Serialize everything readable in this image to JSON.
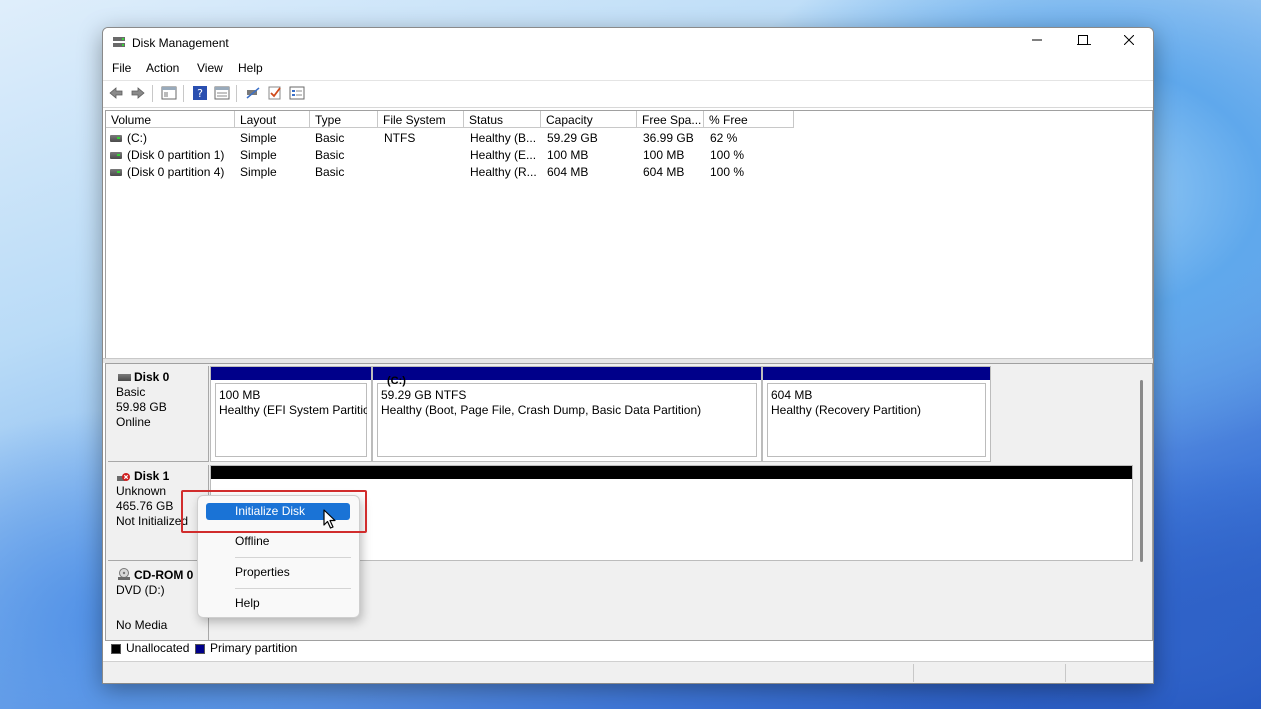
{
  "window": {
    "title": "Disk Management",
    "controls": {
      "minimize": "—",
      "maximize": "☐",
      "close": "✕"
    }
  },
  "menu": [
    "File",
    "Action",
    "View",
    "Help"
  ],
  "toolbar_icons": [
    "back-arrow-icon",
    "forward-arrow-icon",
    "console-tree-icon",
    "help-icon",
    "properties-icon",
    "connect-icon",
    "check-icon",
    "list-icon"
  ],
  "volume_list": {
    "columns": [
      "Volume",
      "Layout",
      "Type",
      "File System",
      "Status",
      "Capacity",
      "Free Spa...",
      "% Free"
    ],
    "rows": [
      [
        "(C:)",
        "Simple",
        "Basic",
        "NTFS",
        "Healthy (B...",
        "59.29 GB",
        "36.99 GB",
        "62 %"
      ],
      [
        "(Disk 0 partition 1)",
        "Simple",
        "Basic",
        "",
        "Healthy (E...",
        "100 MB",
        "100 MB",
        "100 %"
      ],
      [
        "(Disk 0 partition 4)",
        "Simple",
        "Basic",
        "",
        "Healthy (R...",
        "604 MB",
        "604 MB",
        "100 %"
      ]
    ]
  },
  "disks": {
    "disk0": {
      "name": "Disk 0",
      "type": "Basic",
      "size": "59.98 GB",
      "status": "Online",
      "partitions": [
        {
          "label": "",
          "size": "100 MB",
          "status": "Healthy (EFI System Partition)"
        },
        {
          "label": "(C:)",
          "size": "59.29 GB NTFS",
          "status": "Healthy (Boot, Page File, Crash Dump, Basic Data Partition)"
        },
        {
          "label": "",
          "size": "604 MB",
          "status": "Healthy (Recovery Partition)"
        }
      ]
    },
    "disk1": {
      "name": "Disk 1",
      "type": "Unknown",
      "size": "465.76 GB",
      "status": "Not Initialized"
    },
    "cdrom0": {
      "name": "CD-ROM 0",
      "type": "DVD (D:)",
      "status": "No Media"
    }
  },
  "legend": {
    "unallocated": "Unallocated",
    "primary": "Primary partition",
    "unallocated_color": "#000000",
    "primary_color": "#00008a"
  },
  "context_menu": {
    "initialize": "Initialize Disk",
    "offline": "Offline",
    "properties": "Properties",
    "help": "Help"
  },
  "colors": {
    "accent": "#1a73d6",
    "highlight": "#d12d2d",
    "partition_bar": "#00008a"
  }
}
